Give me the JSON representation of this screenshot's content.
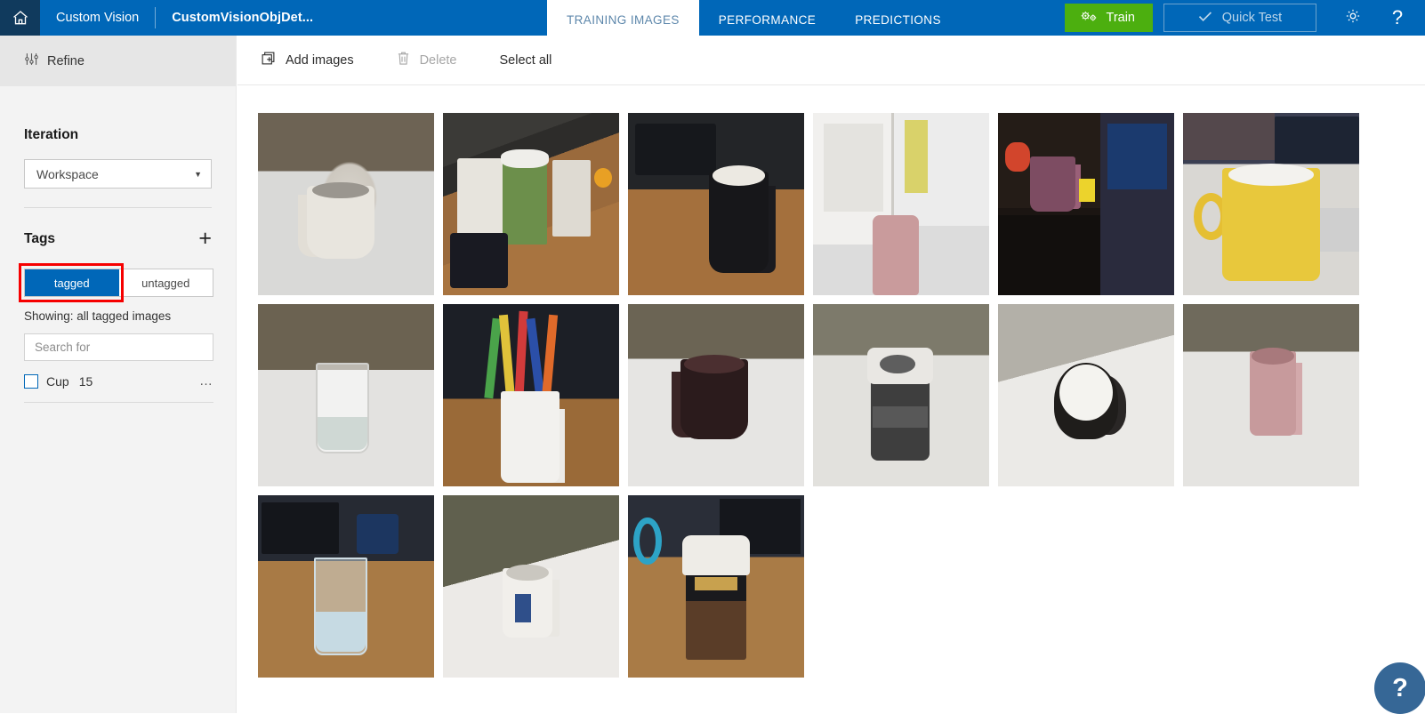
{
  "header": {
    "home_icon": "home-icon",
    "brand": "Custom Vision",
    "project_name": "CustomVisionObjDet...",
    "tabs": [
      {
        "label": "TRAINING IMAGES",
        "active": true
      },
      {
        "label": "PERFORMANCE",
        "active": false
      },
      {
        "label": "PREDICTIONS",
        "active": false
      }
    ],
    "train_button": "Train",
    "train_icon": "gears-icon",
    "train_color": "#4caf0f",
    "quick_test_button": "Quick Test",
    "quick_test_icon": "checkmark-icon",
    "settings_icon": "gear-icon",
    "help_icon": "question-mark-icon",
    "background_color": "#0067b8",
    "home_cell_color": "#103a5d"
  },
  "sidebar": {
    "refine_label": "Refine",
    "refine_icon": "sliders-icon",
    "iteration_title": "Iteration",
    "iteration_value": "Workspace",
    "iteration_caret": "chevron-down-icon",
    "tags_title": "Tags",
    "add_tag_icon": "plus-icon",
    "toggle": {
      "tagged_label": "tagged",
      "untagged_label": "untagged",
      "selected": "tagged",
      "highlight_color": "#f60000",
      "selected_color": "#0067b8"
    },
    "showing_text": "Showing: all tagged images",
    "search_placeholder": "Search for",
    "search_value": "",
    "tags": [
      {
        "name": "Cup",
        "count": "15",
        "checked": false,
        "more_icon": "ellipsis-icon"
      }
    ]
  },
  "toolbar": {
    "add_images_label": "Add images",
    "add_images_icon": "add-image-icon",
    "delete_label": "Delete",
    "delete_icon": "trash-icon",
    "delete_disabled": true,
    "select_all_label": "Select all"
  },
  "grid": {
    "images": [
      {
        "alt": "white ceramic mug on white table",
        "style": "p1"
      },
      {
        "alt": "green takeaway cup and white mug on wooden desk",
        "style": "p2"
      },
      {
        "alt": "black Do Epic mug on wooden desk with keyboard",
        "style": "p3"
      },
      {
        "alt": "pink mug on white counter near microwave",
        "style": "p4"
      },
      {
        "alt": "purple mug on dark bookshelf",
        "style": "p5"
      },
      {
        "alt": "yellow mug on white desk by monitor",
        "style": "p6"
      },
      {
        "alt": "empty drinking glass on white table",
        "style": "p7"
      },
      {
        "alt": "white Microsoft mug holding coloured pencils",
        "style": "p8"
      },
      {
        "alt": "dark brown mug on white table",
        "style": "p9"
      },
      {
        "alt": "grey Microsoft travel mug with lid",
        "style": "p10"
      },
      {
        "alt": "black and white Microsoft cup on white table",
        "style": "p11"
      },
      {
        "alt": "pink tall mug on white table",
        "style": "p12"
      },
      {
        "alt": "glass of water on wooden desk with keyboard",
        "style": "p13"
      },
      {
        "alt": "white mug with cartoon character on white table",
        "style": "p14"
      },
      {
        "alt": "Allpress takeaway coffee cup on wooden desk",
        "style": "p15"
      }
    ]
  },
  "fab": {
    "icon": "question-mark-icon",
    "label": "?",
    "color": "#366796"
  }
}
